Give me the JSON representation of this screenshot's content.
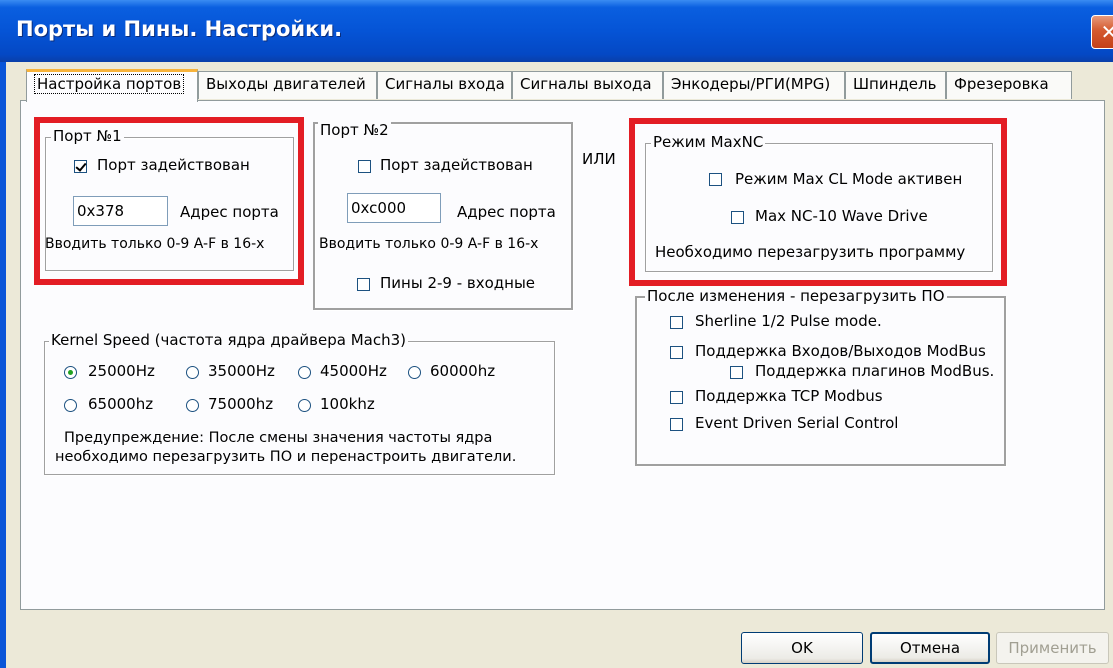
{
  "window": {
    "title": "Порты и Пины.   Настройки.",
    "close_icon": "✕"
  },
  "tabs": [
    {
      "label": "Настройка портов",
      "active": true
    },
    {
      "label": "Выходы двигателей"
    },
    {
      "label": "Сигналы входа"
    },
    {
      "label": "Сигналы выхода"
    },
    {
      "label": "Энкодеры/РГИ(MPG)"
    },
    {
      "label": "Шпиндель"
    },
    {
      "label": "Фрезеровка"
    }
  ],
  "port1": {
    "title": "Порт №1",
    "enabled_label": "Порт задействован",
    "enabled": true,
    "address_value": "0x378",
    "address_label": "Адрес порта",
    "hint": "Вводить только 0-9 A-F в 16-х"
  },
  "port2": {
    "title": "Порт №2",
    "enabled_label": "Порт задействован",
    "enabled": false,
    "address_value": "0xc000",
    "address_label": "Адрес порта",
    "hint": "Вводить только 0-9 A-F в 16-х",
    "pins_label": "Пины 2-9 - входные",
    "pins": false
  },
  "or_label": "ИЛИ",
  "maxnc": {
    "title": "Режим MaxNC",
    "cl_label": "Режим Max CL Mode активен",
    "wave_label": "Max NC-10 Wave Drive",
    "note": "Необходимо перезагрузить программу"
  },
  "restart_group": {
    "title": "После изменения - перезагрузить ПО",
    "items": [
      "Sherline 1/2 Pulse mode.",
      "Поддержка Входов/Выходов ModBus",
      "Поддержка плагинов ModBus.",
      "Поддержка TCP Modbus",
      "Event Driven Serial Control"
    ]
  },
  "kernel": {
    "title": "Kernel Speed (частота ядра драйвера Mach3)",
    "options": [
      "25000Hz",
      "35000Hz",
      "45000Hz",
      "60000hz",
      "65000hz",
      "75000hz",
      "100khz"
    ],
    "selected": "25000Hz",
    "warning_line1": "Предупреждение: После смены значения частоты ядра",
    "warning_line2": "необходимо перезагрузить ПО и перенастроить двигатели."
  },
  "buttons": {
    "ok": "OK",
    "cancel": "Отмена",
    "apply": "Применить"
  },
  "colors": {
    "highlight": "#e31d24",
    "titlebar": "#0554d6",
    "tab_accent": "#f7b33b"
  }
}
